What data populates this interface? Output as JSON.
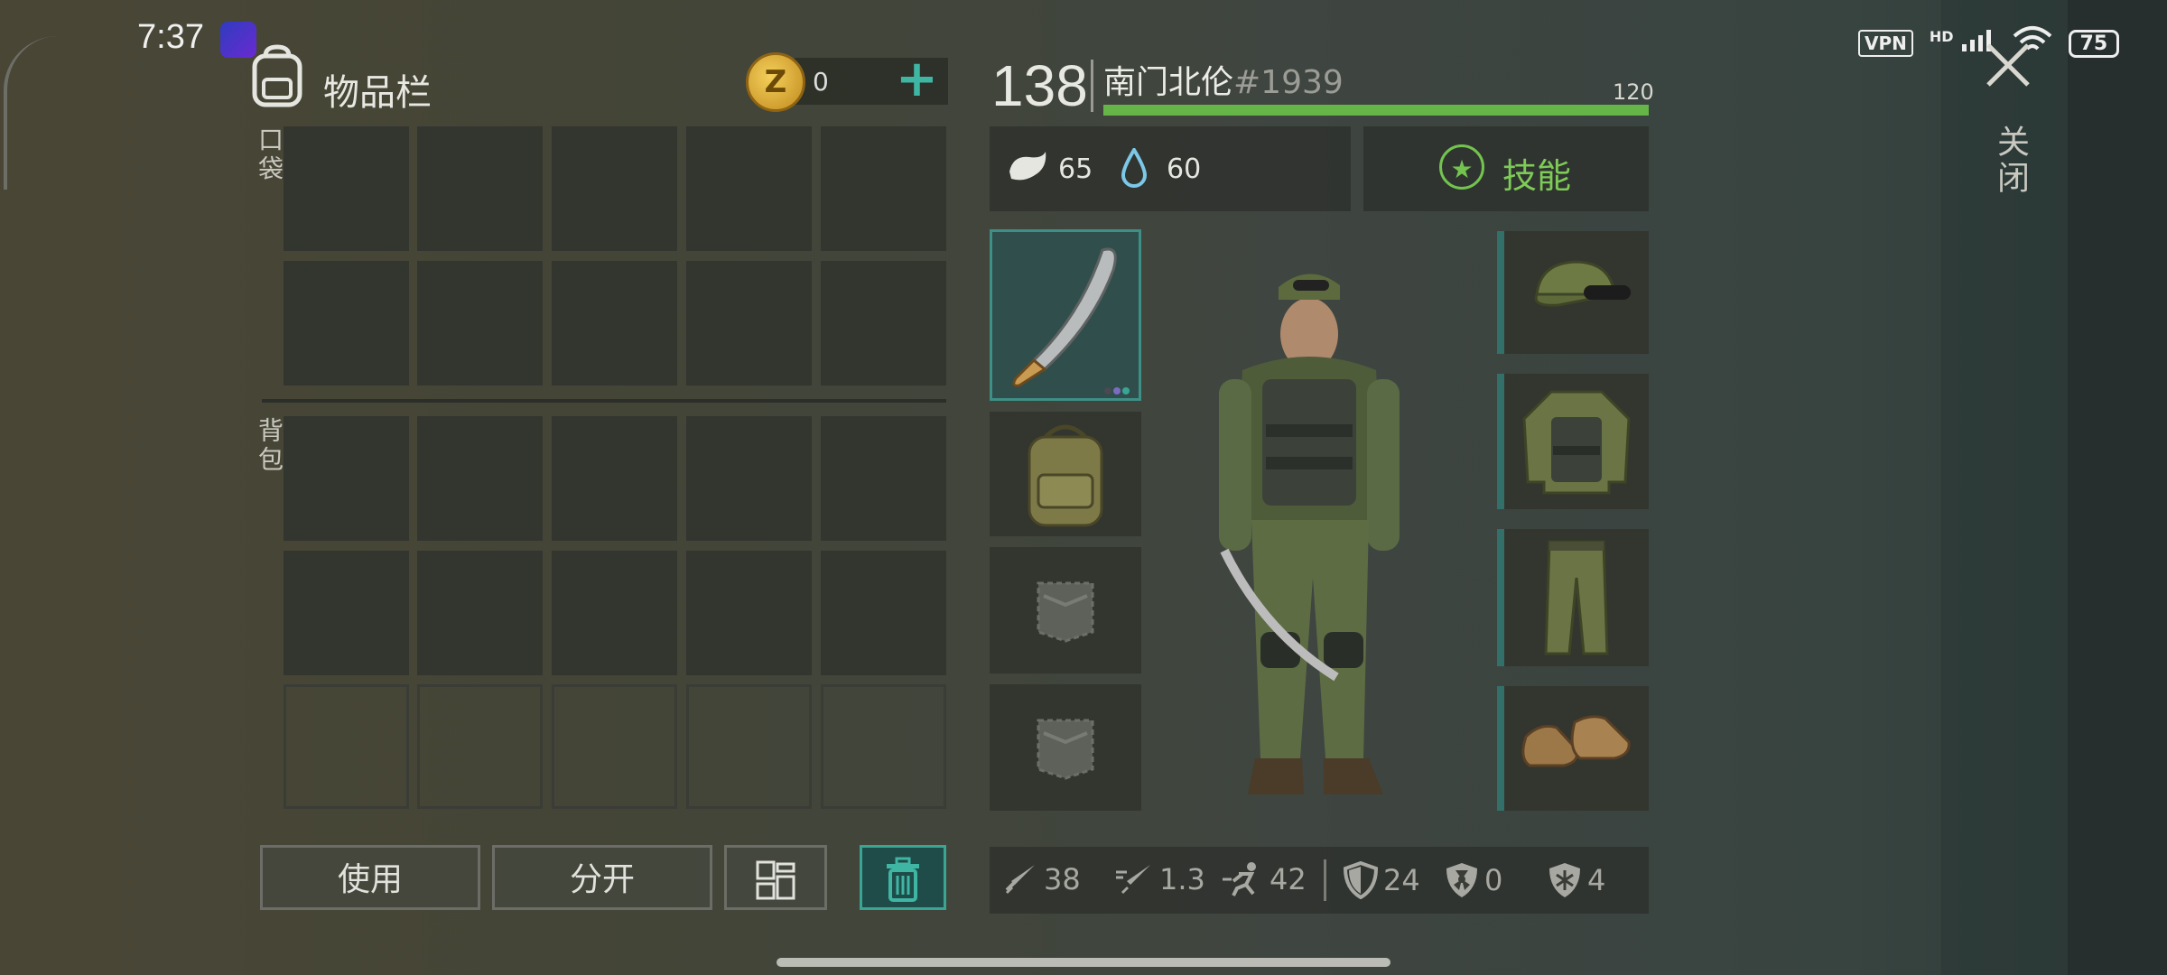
{
  "status_bar": {
    "time": "7:37",
    "vpn": "VPN",
    "hd": "HD",
    "battery": "75"
  },
  "inventory": {
    "title": "物品栏",
    "coins": "0",
    "pocket_label": "口袋",
    "backpack_label": "背包",
    "buttons": {
      "use": "使用",
      "split": "分开"
    }
  },
  "player": {
    "level": "138",
    "name": "南门北伦",
    "id": "#1939",
    "hp": "120",
    "hunger": "65",
    "thirst": "60",
    "skills_label": "技能"
  },
  "equipment": {
    "weapon": "machete",
    "backpack": "military-backpack",
    "pocket_slots": 2,
    "hat": "camo-cap-with-goggles",
    "body": "camo-jacket-with-vest",
    "legs": "camo-pants",
    "feet": "leather-boots"
  },
  "combat_stats": {
    "damage": "38",
    "attack_speed": "1.3",
    "speed": "42",
    "armor": "24",
    "radiation": "0",
    "cold": "4"
  },
  "close_label": "关闭",
  "colors": {
    "accent": "#3fb5a3",
    "hp_bar": "#66b548",
    "skills": "#7ecb58"
  }
}
